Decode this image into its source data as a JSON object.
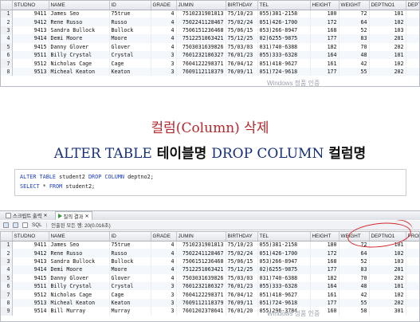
{
  "grid1": {
    "columns": [
      "",
      "STUDNO",
      "NAME",
      "ID",
      "GRADE",
      "JUMIN",
      "BIRTHDAY",
      "TEL",
      "HEIGHT",
      "WEIGHT",
      "DEPTNO1",
      "DEPTNO2"
    ],
    "rows": [
      [
        "1",
        "9411",
        "James Seo",
        "75true",
        "4",
        "7510231901813",
        "75/10/23",
        "055)381-2158",
        "180",
        "72",
        "101",
        "201"
      ],
      [
        "2",
        "9412",
        "Rene Russo",
        "Russo",
        "4",
        "7502241128467",
        "75/02/24",
        "051)426-1700",
        "172",
        "64",
        "102",
        "(null)"
      ],
      [
        "3",
        "9413",
        "Sandra Bullock",
        "Bullock",
        "4",
        "7506151236468",
        "75/06/15",
        "053)266-8947",
        "168",
        "52",
        "103",
        "203"
      ],
      [
        "4",
        "9414",
        "Demi Moore",
        "Moore",
        "4",
        "7512251063421",
        "75/12/25",
        "02)6255-9875",
        "177",
        "83",
        "201",
        "(null)"
      ],
      [
        "5",
        "9415",
        "Danny Glover",
        "Glover",
        "4",
        "7503031639826",
        "75/03/03",
        "031)740-6388",
        "182",
        "70",
        "202",
        "(null)"
      ],
      [
        "6",
        "9511",
        "Billy Crystal",
        "Crystal",
        "3",
        "7601232186327",
        "76/01/23",
        "055)333-6328",
        "164",
        "48",
        "101",
        "(null)"
      ],
      [
        "7",
        "9512",
        "Nicholas Cage",
        "Cage",
        "3",
        "7604122298371",
        "76/04/12",
        "051)418-9627",
        "161",
        "42",
        "102",
        "201"
      ],
      [
        "8",
        "9513",
        "Micheal Keaton",
        "Keaton",
        "3",
        "7609112118379",
        "76/09/11",
        "051)724-9618",
        "177",
        "55",
        "202",
        "(null)"
      ]
    ]
  },
  "heading": {
    "title_ko": "컬럼(Column) 삭제",
    "kw_alter": "ALTER TABLE",
    "tablename": "테이블명",
    "kw_drop": "DROP COLUMN",
    "colname": "컬럼명"
  },
  "editor": {
    "line1_kw1": "ALTER TABLE",
    "line1_t1": "student2",
    "line1_kw2": "DROP COLUMN",
    "line1_t2": "deptno2;",
    "line2_kw1": "SELECT",
    "line2_t1": "*",
    "line2_kw2": "FROM",
    "line2_t2": "student2;"
  },
  "toolbar": {
    "tab1": "스크립트 출력",
    "tab2": "질의 결과",
    "sql_label": "SQL",
    "status": "인출된 모든 행: 20(0.016초)"
  },
  "watermark": {
    "top": "Windows 정품 인증",
    "bottom": "Windows 정품 인증"
  },
  "grid2": {
    "columns": [
      "",
      "STUDNO",
      "NAME",
      "ID",
      "GRADE",
      "JUMIN",
      "BIRTHDAY",
      "TEL",
      "HEIGHT",
      "WEIGHT",
      "DEPTNO1",
      "PROFNO"
    ],
    "rows": [
      [
        "1",
        "9411",
        "James Seo",
        "75true",
        "4",
        "7510231901813",
        "75/10/23",
        "055)381-2158",
        "180",
        "72",
        "101",
        "1001"
      ],
      [
        "2",
        "9412",
        "Rene Russo",
        "Russo",
        "4",
        "7502241128467",
        "75/02/24",
        "051)426-1700",
        "172",
        "64",
        "102",
        "2001"
      ],
      [
        "3",
        "9413",
        "Sandra Bullock",
        "Bullock",
        "4",
        "7506151236468",
        "75/06/15",
        "053)266-8947",
        "168",
        "52",
        "103",
        "3002"
      ],
      [
        "4",
        "9414",
        "Demi Moore",
        "Moore",
        "4",
        "7512251063421",
        "75/12/25",
        "02)6255-9875",
        "177",
        "83",
        "201",
        "4001"
      ],
      [
        "5",
        "9415",
        "Danny Glover",
        "Glover",
        "4",
        "7503031639826",
        "75/03/03",
        "031)740-6388",
        "182",
        "70",
        "202",
        "4003"
      ],
      [
        "6",
        "9511",
        "Billy Crystal",
        "Crystal",
        "3",
        "7601232186327",
        "76/01/23",
        "055)333-6328",
        "164",
        "48",
        "101",
        "1002"
      ],
      [
        "7",
        "9512",
        "Nicholas Cage",
        "Cage",
        "3",
        "7604122298371",
        "76/04/12",
        "051)418-9627",
        "161",
        "42",
        "102",
        "2002"
      ],
      [
        "8",
        "9513",
        "Micheal Keaton",
        "Keaton",
        "3",
        "7609112118379",
        "76/09/11",
        "051)724-9618",
        "177",
        "55",
        "202",
        "4003"
      ],
      [
        "9",
        "9514",
        "Bill Murray",
        "Murray",
        "3",
        "7601202378641",
        "76/01/20",
        "055)296-3784",
        "160",
        "58",
        "301",
        "4007"
      ]
    ]
  }
}
